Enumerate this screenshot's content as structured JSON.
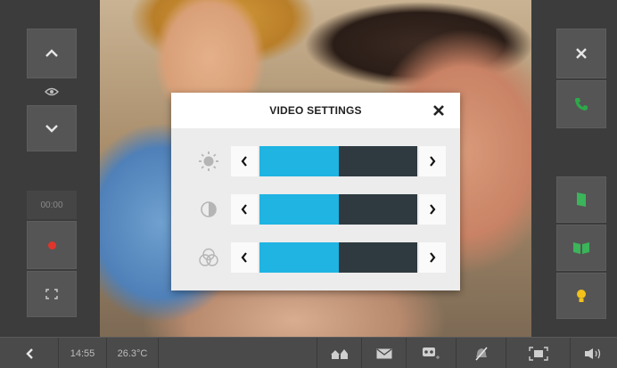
{
  "dialog": {
    "title": "VIDEO SETTINGS",
    "settings": [
      {
        "name": "brightness",
        "icon": "brightness-icon",
        "level": 0.5
      },
      {
        "name": "contrast",
        "icon": "contrast-icon",
        "level": 0.5
      },
      {
        "name": "color",
        "icon": "color-saturation-icon",
        "level": 0.5
      }
    ]
  },
  "left_panel": {
    "timer": "00:00"
  },
  "bottom_bar": {
    "time": "14:55",
    "temperature": "26.3°C"
  },
  "colors": {
    "accent": "#1fb4e2",
    "panel": "#3c3c3c",
    "button": "#555555",
    "call_green": "#2ea84a",
    "door_green": "#3bb45a",
    "light_yellow": "#f2c21b",
    "record_red": "#e0352b"
  }
}
